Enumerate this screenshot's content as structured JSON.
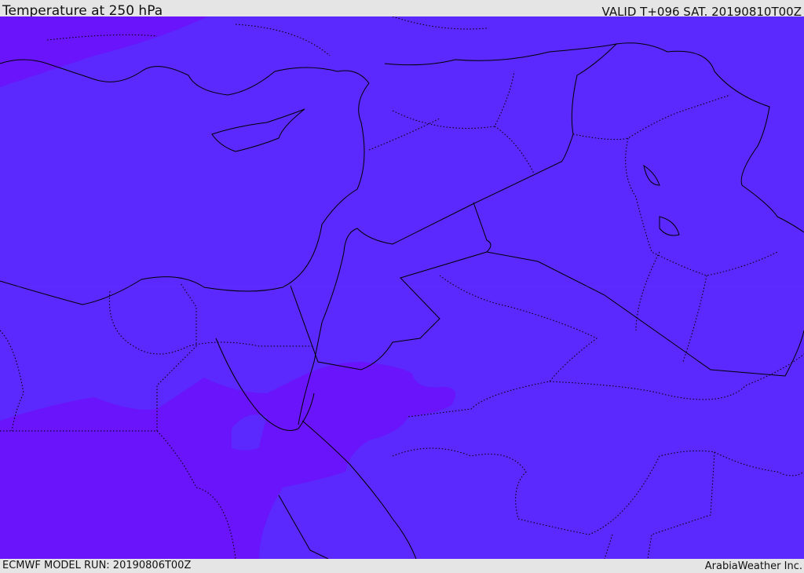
{
  "header": {
    "title": "Temperature at 250 hPa",
    "valid": "VALID T+096 SAT. 20190810T00Z"
  },
  "footer": {
    "model_run": "ECMWF MODEL RUN: 20190806T00Z",
    "brand": "ArabiaWeather Inc."
  },
  "map": {
    "field": "temperature",
    "level": "250 hPa",
    "colors": {
      "main": "#5b28fd",
      "warm": "#6a14fc",
      "ne_corner": "#6e10f0",
      "coast": "#000000"
    }
  }
}
